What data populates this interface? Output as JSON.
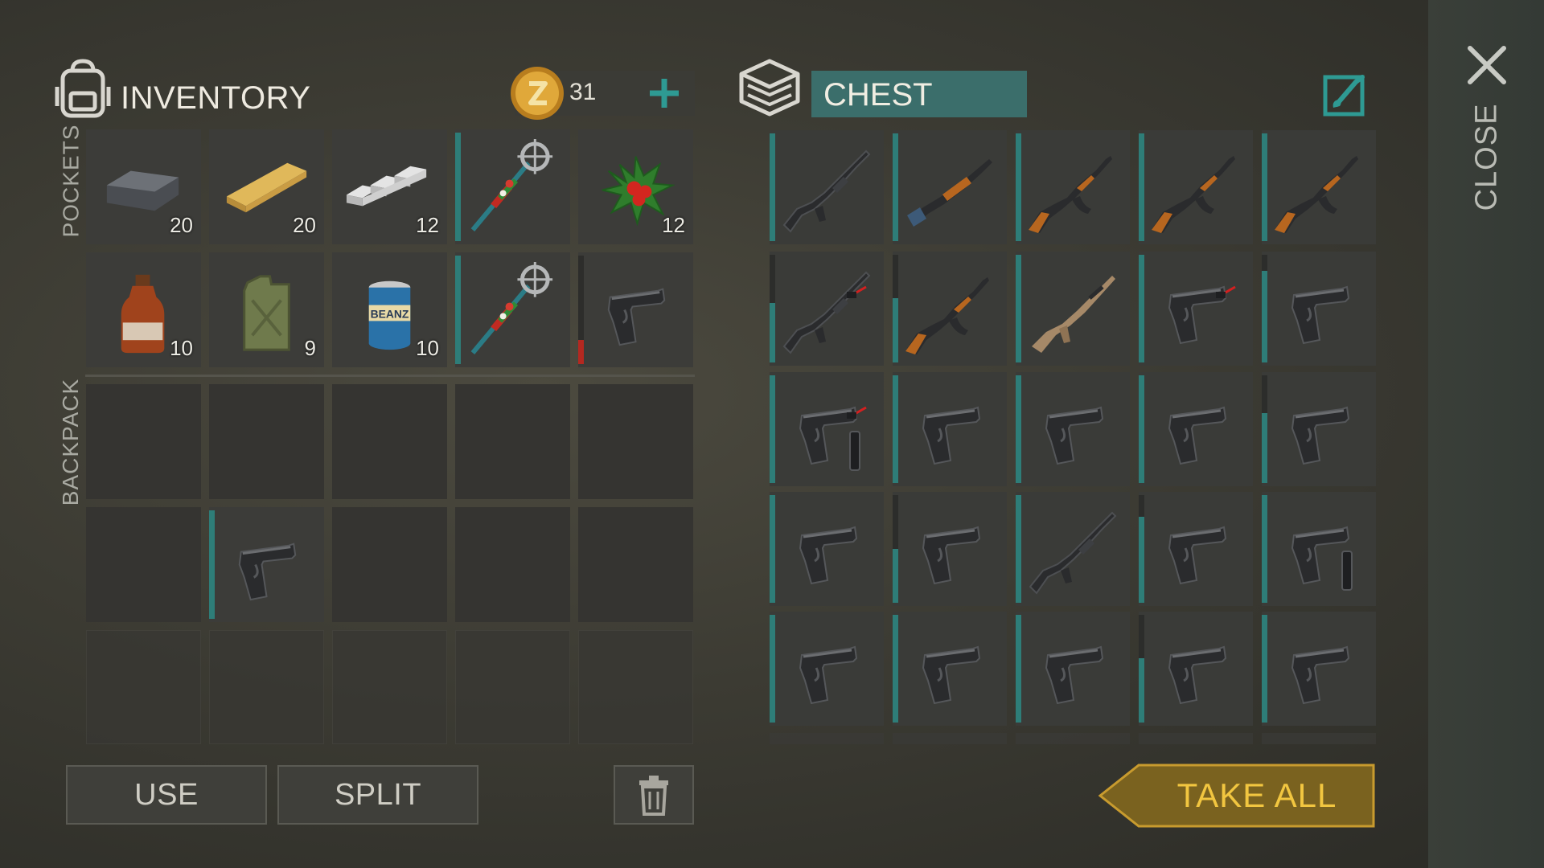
{
  "colors": {
    "accent_teal": "#2e7d78",
    "gold": "#f2c640",
    "durability_red": "#b42820"
  },
  "inventory": {
    "title": "INVENTORY",
    "icon": "backpack-icon",
    "coins": {
      "count": "31",
      "icon": "coin-icon",
      "add_icon": "plus-icon"
    },
    "pockets_label": "POCKETS",
    "backpack_label": "BACKPACK",
    "pockets": [
      {
        "item": "iron-ingot",
        "count": "20"
      },
      {
        "item": "wood-plank",
        "count": "20"
      },
      {
        "item": "aluminum-bars",
        "count": "12"
      },
      {
        "item": "festive-staff",
        "count": "",
        "durability": 1.0
      },
      {
        "item": "holly",
        "count": "12"
      },
      {
        "item": "brown-bottle",
        "count": "10"
      },
      {
        "item": "gas-canister",
        "count": "9"
      },
      {
        "item": "beanz-can",
        "count": "10"
      },
      {
        "item": "festive-staff",
        "count": "",
        "durability": 1.0
      },
      {
        "item": "pistol",
        "count": "",
        "durability": 0.22,
        "durability_color": "red"
      }
    ],
    "backpack": [
      {
        "item": "",
        "count": ""
      },
      {
        "item": "",
        "count": ""
      },
      {
        "item": "",
        "count": ""
      },
      {
        "item": "",
        "count": ""
      },
      {
        "item": "",
        "count": ""
      },
      {
        "item": "",
        "count": ""
      },
      {
        "item": "pistol",
        "count": "",
        "durability": 1.0
      },
      {
        "item": "",
        "count": ""
      },
      {
        "item": "",
        "count": ""
      },
      {
        "item": "",
        "count": ""
      }
    ]
  },
  "chest": {
    "title": "CHEST",
    "icon": "chest-icon",
    "edit_icon": "edit-brush-icon",
    "items": [
      {
        "item": "m4-rifle",
        "durability": 1.0
      },
      {
        "item": "shotgun",
        "durability": 1.0
      },
      {
        "item": "ak-rifle",
        "durability": 1.0
      },
      {
        "item": "ak-rifle",
        "durability": 1.0
      },
      {
        "item": "ak-rifle",
        "durability": 1.0
      },
      {
        "item": "m4-rifle-laser",
        "durability": 0.55
      },
      {
        "item": "ak-rifle",
        "durability": 0.6
      },
      {
        "item": "scar-rifle",
        "durability": 1.0
      },
      {
        "item": "pistol-laser",
        "durability": 1.0
      },
      {
        "item": "pistol",
        "durability": 0.85
      },
      {
        "item": "pistol-laser-silencer",
        "durability": 1.0
      },
      {
        "item": "pistol",
        "durability": 1.0
      },
      {
        "item": "pistol",
        "durability": 1.0
      },
      {
        "item": "pistol",
        "durability": 1.0
      },
      {
        "item": "pistol",
        "durability": 0.65
      },
      {
        "item": "pistol",
        "durability": 1.0
      },
      {
        "item": "pistol",
        "durability": 0.5
      },
      {
        "item": "m4-rifle",
        "durability": 1.0
      },
      {
        "item": "pistol",
        "durability": 0.8
      },
      {
        "item": "pistol-silencer",
        "durability": 1.0
      },
      {
        "item": "pistol",
        "durability": 1.0
      },
      {
        "item": "pistol-extended",
        "durability": 1.0
      },
      {
        "item": "pistol",
        "durability": 1.0
      },
      {
        "item": "pistol",
        "durability": 0.6
      },
      {
        "item": "pistol",
        "durability": 1.0
      }
    ]
  },
  "actions": {
    "use": "USE",
    "split": "SPLIT",
    "trash_icon": "trash-icon",
    "take_all": "TAKE ALL"
  },
  "close": {
    "label": "CLOSE",
    "icon": "close-icon"
  }
}
